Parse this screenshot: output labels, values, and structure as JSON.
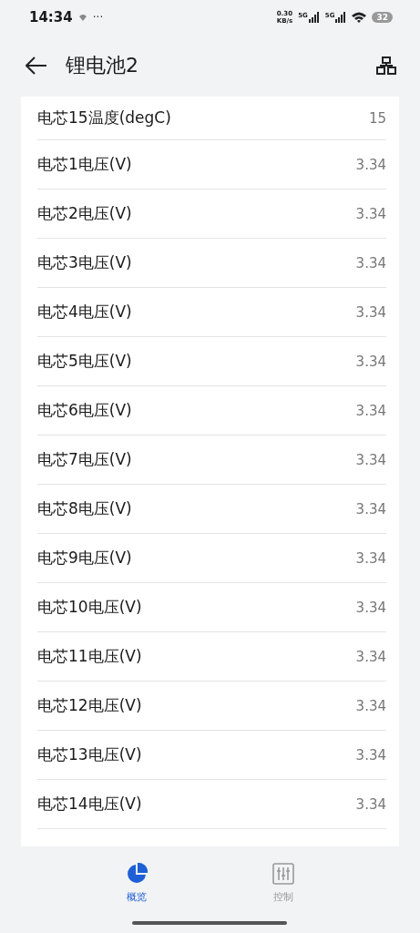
{
  "status_bar": {
    "time": "14:34",
    "more": "···",
    "speed_value": "0.30",
    "speed_unit": "KB/s",
    "networks": [
      "5G",
      "5G"
    ],
    "battery": "32"
  },
  "header": {
    "title": "锂电池2"
  },
  "rows": [
    {
      "label": "电芯15温度(degC)",
      "value": "15"
    },
    {
      "label": "电芯1电压(V)",
      "value": "3.34"
    },
    {
      "label": "电芯2电压(V)",
      "value": "3.34"
    },
    {
      "label": "电芯3电压(V)",
      "value": "3.34"
    },
    {
      "label": "电芯4电压(V)",
      "value": "3.34"
    },
    {
      "label": "电芯5电压(V)",
      "value": "3.34"
    },
    {
      "label": "电芯6电压(V)",
      "value": "3.34"
    },
    {
      "label": "电芯7电压(V)",
      "value": "3.34"
    },
    {
      "label": "电芯8电压(V)",
      "value": "3.34"
    },
    {
      "label": "电芯9电压(V)",
      "value": "3.34"
    },
    {
      "label": "电芯10电压(V)",
      "value": "3.34"
    },
    {
      "label": "电芯11电压(V)",
      "value": "3.34"
    },
    {
      "label": "电芯12电压(V)",
      "value": "3.34"
    },
    {
      "label": "电芯13电压(V)",
      "value": "3.34"
    },
    {
      "label": "电芯14电压(V)",
      "value": "3.34"
    }
  ],
  "tabs": [
    {
      "kind": "overview",
      "label": "概览",
      "selected": true
    },
    {
      "kind": "control",
      "label": "控制",
      "selected": false
    }
  ]
}
